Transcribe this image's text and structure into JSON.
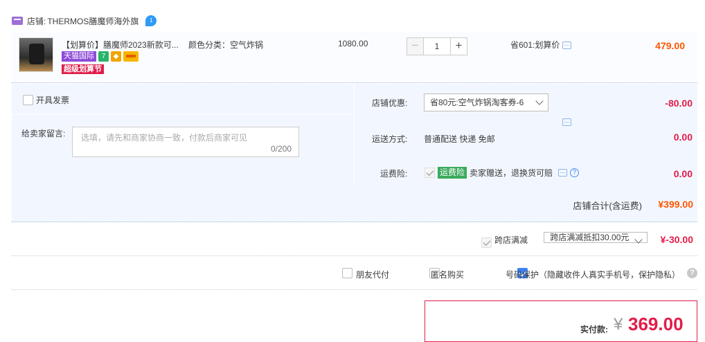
{
  "store": {
    "prefix": "店铺:",
    "name": "THERMOS膳魔师海外旗",
    "ww_badge": "1"
  },
  "item": {
    "title": "【划算价】膳魔师2023新款可...",
    "tags": {
      "tmall": "天猫国际",
      "seven": "7",
      "super": "超级划算节"
    },
    "sku": "颜色分类：空气炸锅",
    "unit_price": "1080.00",
    "qty_minus": "−",
    "quantity": "1",
    "qty_plus": "+",
    "save_text": "省601:划算价",
    "total": "479.00"
  },
  "options": {
    "invoice_label": "开具发票",
    "message_label": "给卖家留言:",
    "message_placeholder": "选填，请先和商家协商一致，付款后商家可见",
    "message_count": "0/200",
    "store_discount_label": "店铺优惠:",
    "store_discount_value": "省80元:空气炸锅淘客券-6",
    "store_discount_amount": "-80.00",
    "shipping_label": "运送方式:",
    "shipping_value": "普通配送 快递 免邮",
    "shipping_amount": "0.00",
    "insurance_label": "运费险:",
    "insurance_tag": "运费险",
    "insurance_text": "卖家赠送，退换货可赔",
    "insurance_amount": "0.00",
    "help_glyph": "?"
  },
  "store_total": {
    "label": "店铺合计(含运费)",
    "value": "¥399.00"
  },
  "cross_store": {
    "label": "跨店满减",
    "select_value": "跨店满减抵扣30.00元",
    "amount": "¥-30.00"
  },
  "extra_options": {
    "friend_pay": "朋友代付",
    "anonymous": "匿名购买",
    "number_protect": "号码保护（隐藏收件人真实手机号，保护隐私）",
    "help": "?"
  },
  "payment": {
    "label": "实付款:",
    "currency": "¥",
    "amount": "369.00"
  },
  "colors": {
    "accent": "#ff5500",
    "price_red": "#e21c49",
    "panel_bg": "#f2f7ff",
    "tmall_purple": "#8e4bd8"
  }
}
